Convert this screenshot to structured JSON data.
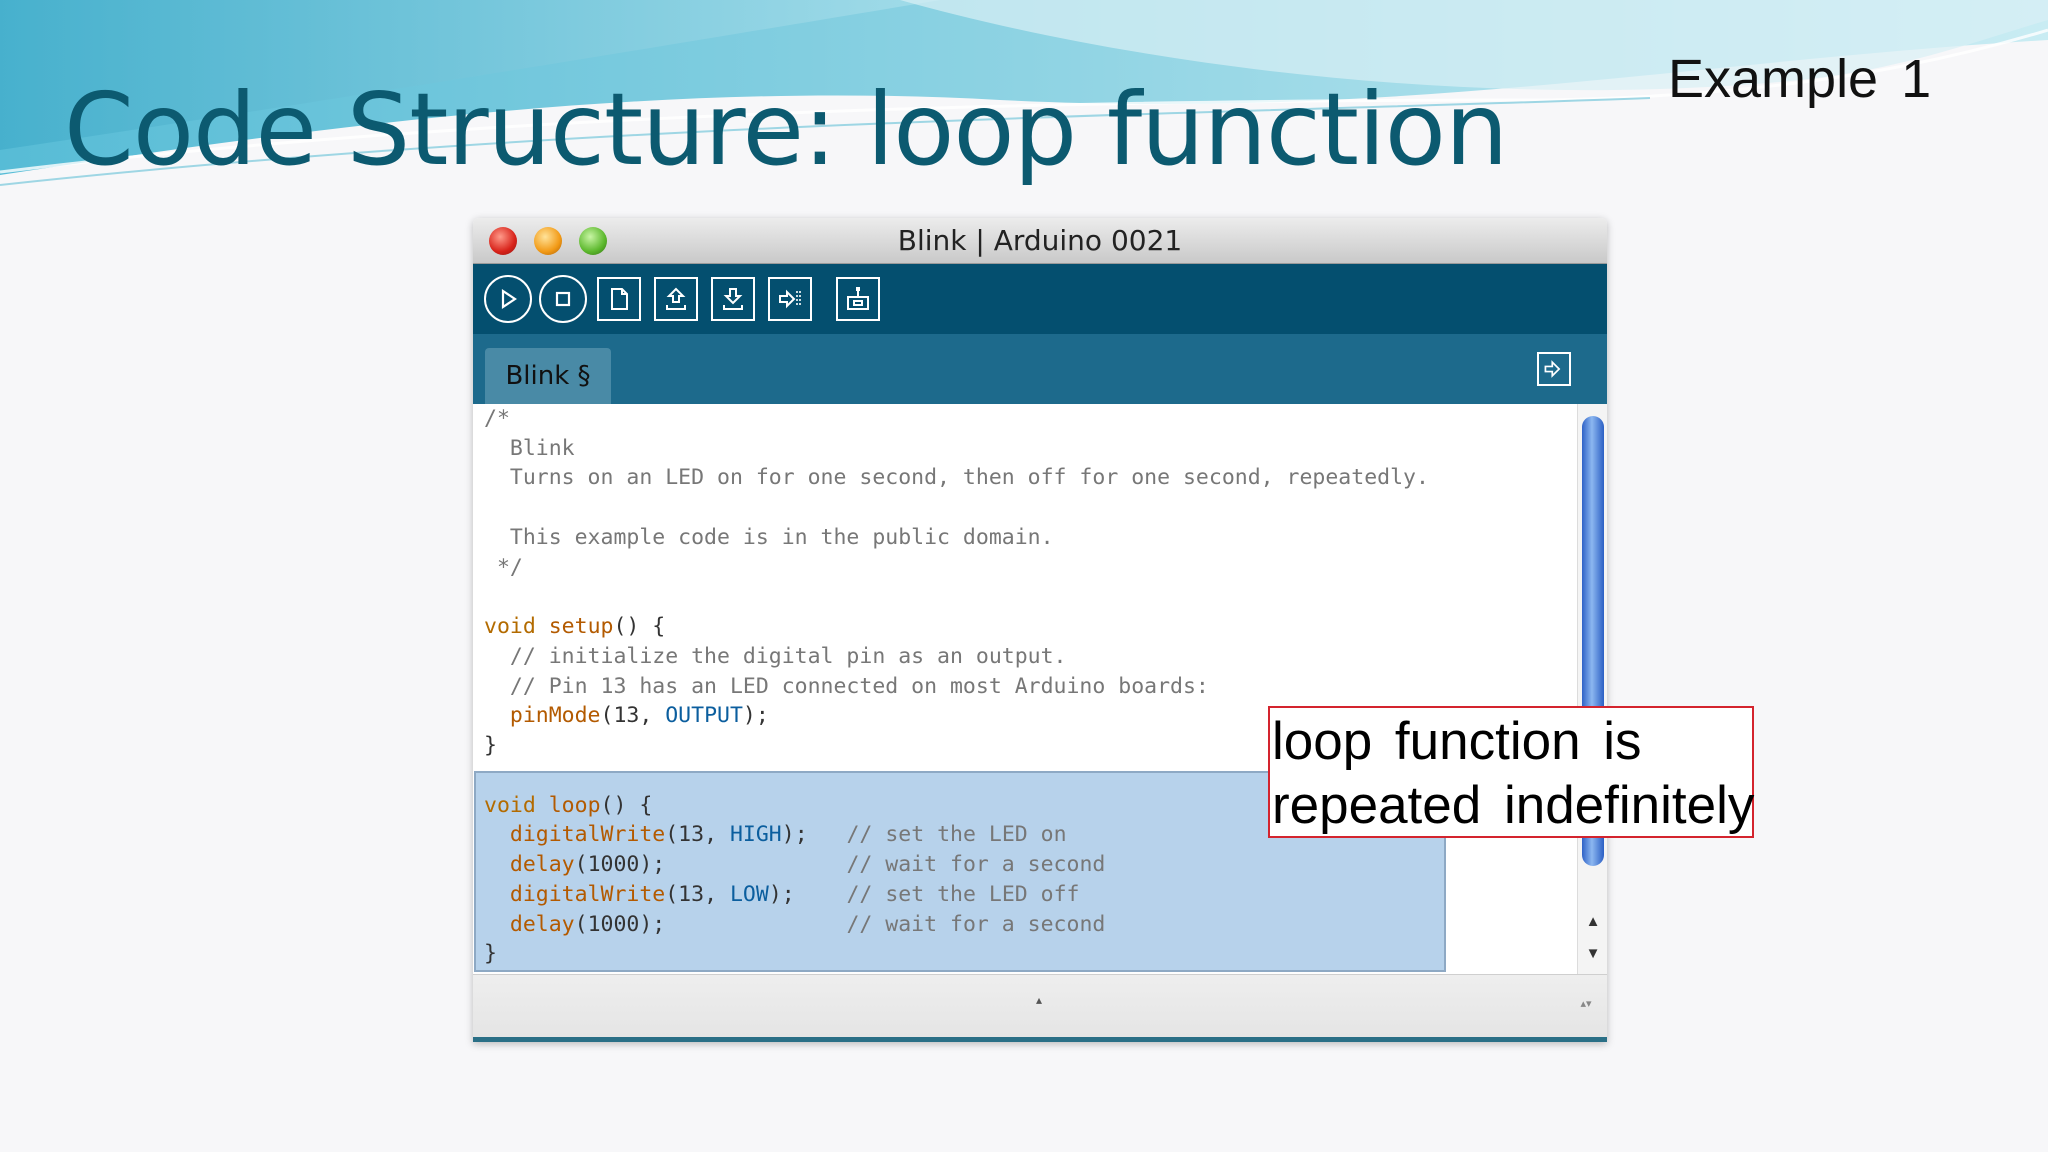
{
  "slide": {
    "title": "Code Structure: loop function",
    "example_label": "Example 1"
  },
  "window": {
    "title": "Blink | Arduino 0021",
    "toolbar": {
      "buttons": [
        "verify-icon",
        "stop-icon",
        "new-icon",
        "open-icon",
        "save-icon",
        "upload-icon",
        "serial-monitor-icon"
      ]
    },
    "tab_label": "Blink §",
    "tab_menu_icon": "tab-menu-icon"
  },
  "code": {
    "lines": [
      [
        {
          "t": "/*",
          "c": "cm"
        }
      ],
      [
        {
          "t": "  Blink",
          "c": "cm"
        }
      ],
      [
        {
          "t": "  Turns on an LED on for one second, then off for one second, repeatedly.",
          "c": "cm"
        }
      ],
      [
        {
          "t": "",
          "c": "cm"
        }
      ],
      [
        {
          "t": "  This example code is in the public domain.",
          "c": "cm"
        }
      ],
      [
        {
          "t": " */",
          "c": "cm"
        }
      ],
      [
        {
          "t": "",
          "c": "tx"
        }
      ],
      [
        {
          "t": "void",
          "c": "kw"
        },
        {
          "t": " ",
          "c": "tx"
        },
        {
          "t": "setup",
          "c": "fn"
        },
        {
          "t": "() {",
          "c": "tx"
        }
      ],
      [
        {
          "t": "  // initialize the digital pin as an output.",
          "c": "cm"
        }
      ],
      [
        {
          "t": "  // Pin 13 has an LED connected on most Arduino boards:",
          "c": "cm"
        }
      ],
      [
        {
          "t": "  ",
          "c": "tx"
        },
        {
          "t": "pinMode",
          "c": "fn"
        },
        {
          "t": "(13, ",
          "c": "tx"
        },
        {
          "t": "OUTPUT",
          "c": "cs"
        },
        {
          "t": ");",
          "c": "tx"
        }
      ],
      [
        {
          "t": "}",
          "c": "tx"
        }
      ],
      [
        {
          "t": "",
          "c": "tx"
        }
      ],
      [
        {
          "t": "void",
          "c": "kw"
        },
        {
          "t": " ",
          "c": "tx"
        },
        {
          "t": "loop",
          "c": "fn"
        },
        {
          "t": "() {",
          "c": "tx"
        }
      ],
      [
        {
          "t": "  ",
          "c": "tx"
        },
        {
          "t": "digitalWrite",
          "c": "fn"
        },
        {
          "t": "(13, ",
          "c": "tx"
        },
        {
          "t": "HIGH",
          "c": "cs"
        },
        {
          "t": ");   ",
          "c": "tx"
        },
        {
          "t": "// set the LED on",
          "c": "cm"
        }
      ],
      [
        {
          "t": "  ",
          "c": "tx"
        },
        {
          "t": "delay",
          "c": "fn"
        },
        {
          "t": "(1000);              ",
          "c": "tx"
        },
        {
          "t": "// wait for a second",
          "c": "cm"
        }
      ],
      [
        {
          "t": "  ",
          "c": "tx"
        },
        {
          "t": "digitalWrite",
          "c": "fn"
        },
        {
          "t": "(13, ",
          "c": "tx"
        },
        {
          "t": "LOW",
          "c": "cs"
        },
        {
          "t": ");    ",
          "c": "tx"
        },
        {
          "t": "// set the LED off",
          "c": "cm"
        }
      ],
      [
        {
          "t": "  ",
          "c": "tx"
        },
        {
          "t": "delay",
          "c": "fn"
        },
        {
          "t": "(1000);              ",
          "c": "tx"
        },
        {
          "t": "// wait for a second",
          "c": "cm"
        }
      ],
      [
        {
          "t": "}",
          "c": "tx"
        }
      ]
    ]
  },
  "callout": {
    "line1": "loop function is",
    "line2": "repeated indefinitely"
  },
  "colors": {
    "title": "#0c5a70",
    "toolbar": "#044f6f",
    "tabbar": "#1d6a8c",
    "highlight": "#b7d2eb",
    "callout_border": "#d4242e"
  }
}
